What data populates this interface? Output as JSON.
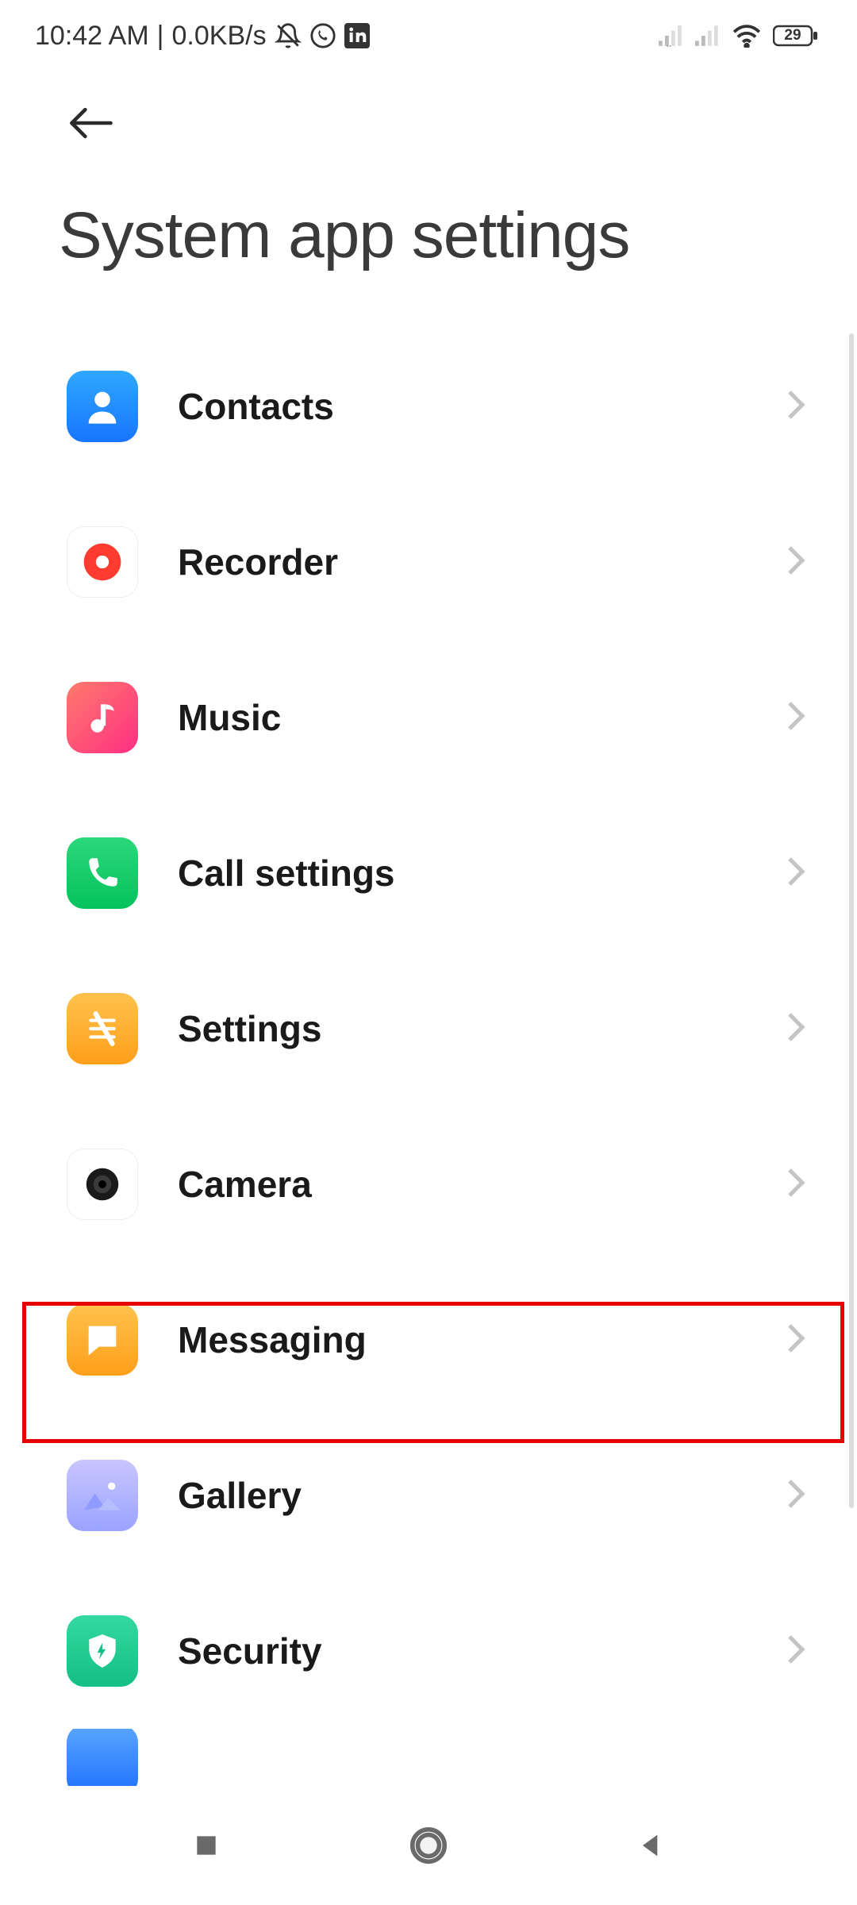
{
  "status": {
    "time": "10:42 AM",
    "speed": "0.0KB/s",
    "battery": "29"
  },
  "header": {
    "title": "System app settings"
  },
  "list": {
    "items": [
      {
        "label": "Contacts",
        "icon": "contacts-icon",
        "bg": "bg-blue"
      },
      {
        "label": "Recorder",
        "icon": "recorder-icon",
        "bg": "bg-white"
      },
      {
        "label": "Music",
        "icon": "music-icon",
        "bg": "bg-music"
      },
      {
        "label": "Call settings",
        "icon": "phone-icon",
        "bg": "bg-green"
      },
      {
        "label": "Settings",
        "icon": "settings-icon",
        "bg": "bg-amber"
      },
      {
        "label": "Camera",
        "icon": "camera-icon",
        "bg": "bg-white"
      },
      {
        "label": "Messaging",
        "icon": "messaging-icon",
        "bg": "bg-amber"
      },
      {
        "label": "Gallery",
        "icon": "gallery-icon",
        "bg": "bg-purple"
      },
      {
        "label": "Security",
        "icon": "security-icon",
        "bg": "bg-emerald"
      }
    ]
  },
  "highlighted_index": 6
}
